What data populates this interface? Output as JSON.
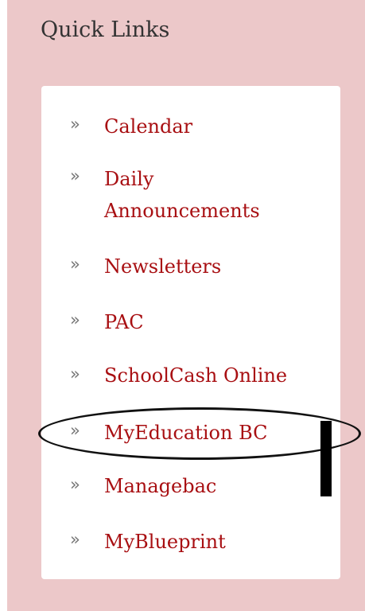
{
  "quick_links": {
    "title": "Quick Links",
    "chevron_glyph": "»",
    "items": [
      {
        "label": "Calendar"
      },
      {
        "label_line1": "Daily",
        "label_line2": "Announcements"
      },
      {
        "label": "Newsletters"
      },
      {
        "label": "PAC"
      },
      {
        "label": "SchoolCash Online"
      },
      {
        "label": "MyEducation BC"
      },
      {
        "label": "Managebac"
      },
      {
        "label": "MyBlueprint"
      }
    ]
  },
  "colors": {
    "panel_background": "#ecc8c9",
    "link_text": "#a80f12",
    "title_text": "#333333",
    "chevron": "#777777"
  }
}
